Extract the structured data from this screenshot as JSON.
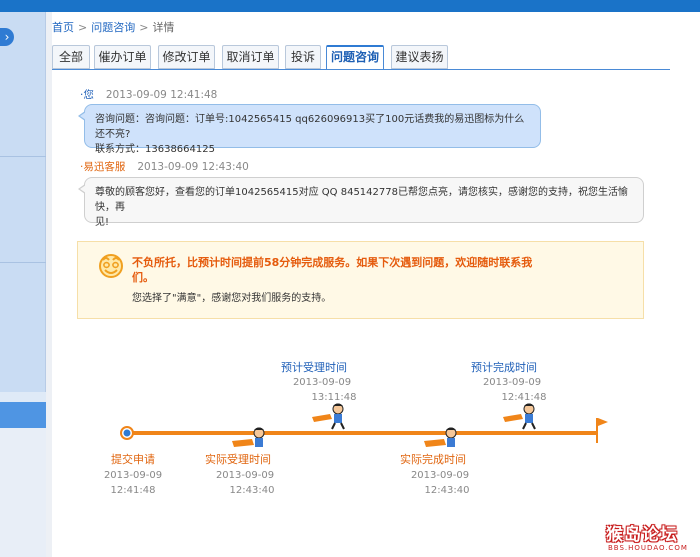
{
  "breadcrumb": {
    "home": "首页",
    "section": "问题咨询",
    "current": "详情"
  },
  "tabs": [
    "全部",
    "催办订单",
    "修改订单",
    "取消订单",
    "投诉",
    "问题咨询",
    "建议表扬"
  ],
  "active_tab": "问题咨询",
  "messages": [
    {
      "who": "您",
      "time": "2013-09-09 12:41:48",
      "line1": "咨询问题：咨询问题：订单号:1042565415 qq626096913买了100元话费我的易迅图标为什么还不亮?",
      "line2": "联系方式：13638664125",
      "who_color": "#2060b8"
    },
    {
      "who": "易迅客服",
      "time": "2013-09-09 12:43:40",
      "line1": "尊敬的顾客您好，查看您的订单1042565415对应 QQ 845142778已帮您点亮，请您核实，感谢您的支持，祝您生活愉快，再",
      "line2": "见!",
      "who_color": "#e0650f"
    }
  ],
  "notice": {
    "title": "不负所托，比预计时间提前58分钟完成服务。如果下次遇到问题，欢迎随时联系我们。",
    "subtitle": "您选择了\"满意\"，感谢您对我们服务的支持。"
  },
  "timeline": {
    "expected_accept": {
      "label": "预计受理时间",
      "date": "2013-09-09",
      "time": "13:11:48"
    },
    "expected_finish": {
      "label": "预计完成时间",
      "date": "2013-09-09",
      "time": "12:41:48"
    },
    "submit": {
      "label": "提交申请",
      "date": "2013-09-09",
      "time": "12:41:48"
    },
    "actual_accept": {
      "label": "实际受理时间",
      "date": "2013-09-09",
      "time": "12:43:40"
    },
    "actual_finish": {
      "label": "实际完成时间",
      "date": "2013-09-09",
      "time": "12:43:40"
    }
  },
  "watermark": {
    "title": "猴岛论坛",
    "url": "BBS.HOUDAO.COM"
  },
  "colors": {
    "accent": "#2f7bd3",
    "orange": "#f08519",
    "link": "#1f66c0"
  },
  "icons": {
    "sidebar_toggle": "chevron-right-icon",
    "notice": "smile-face-icon",
    "timeline_runner": "running-mascot-icon"
  }
}
